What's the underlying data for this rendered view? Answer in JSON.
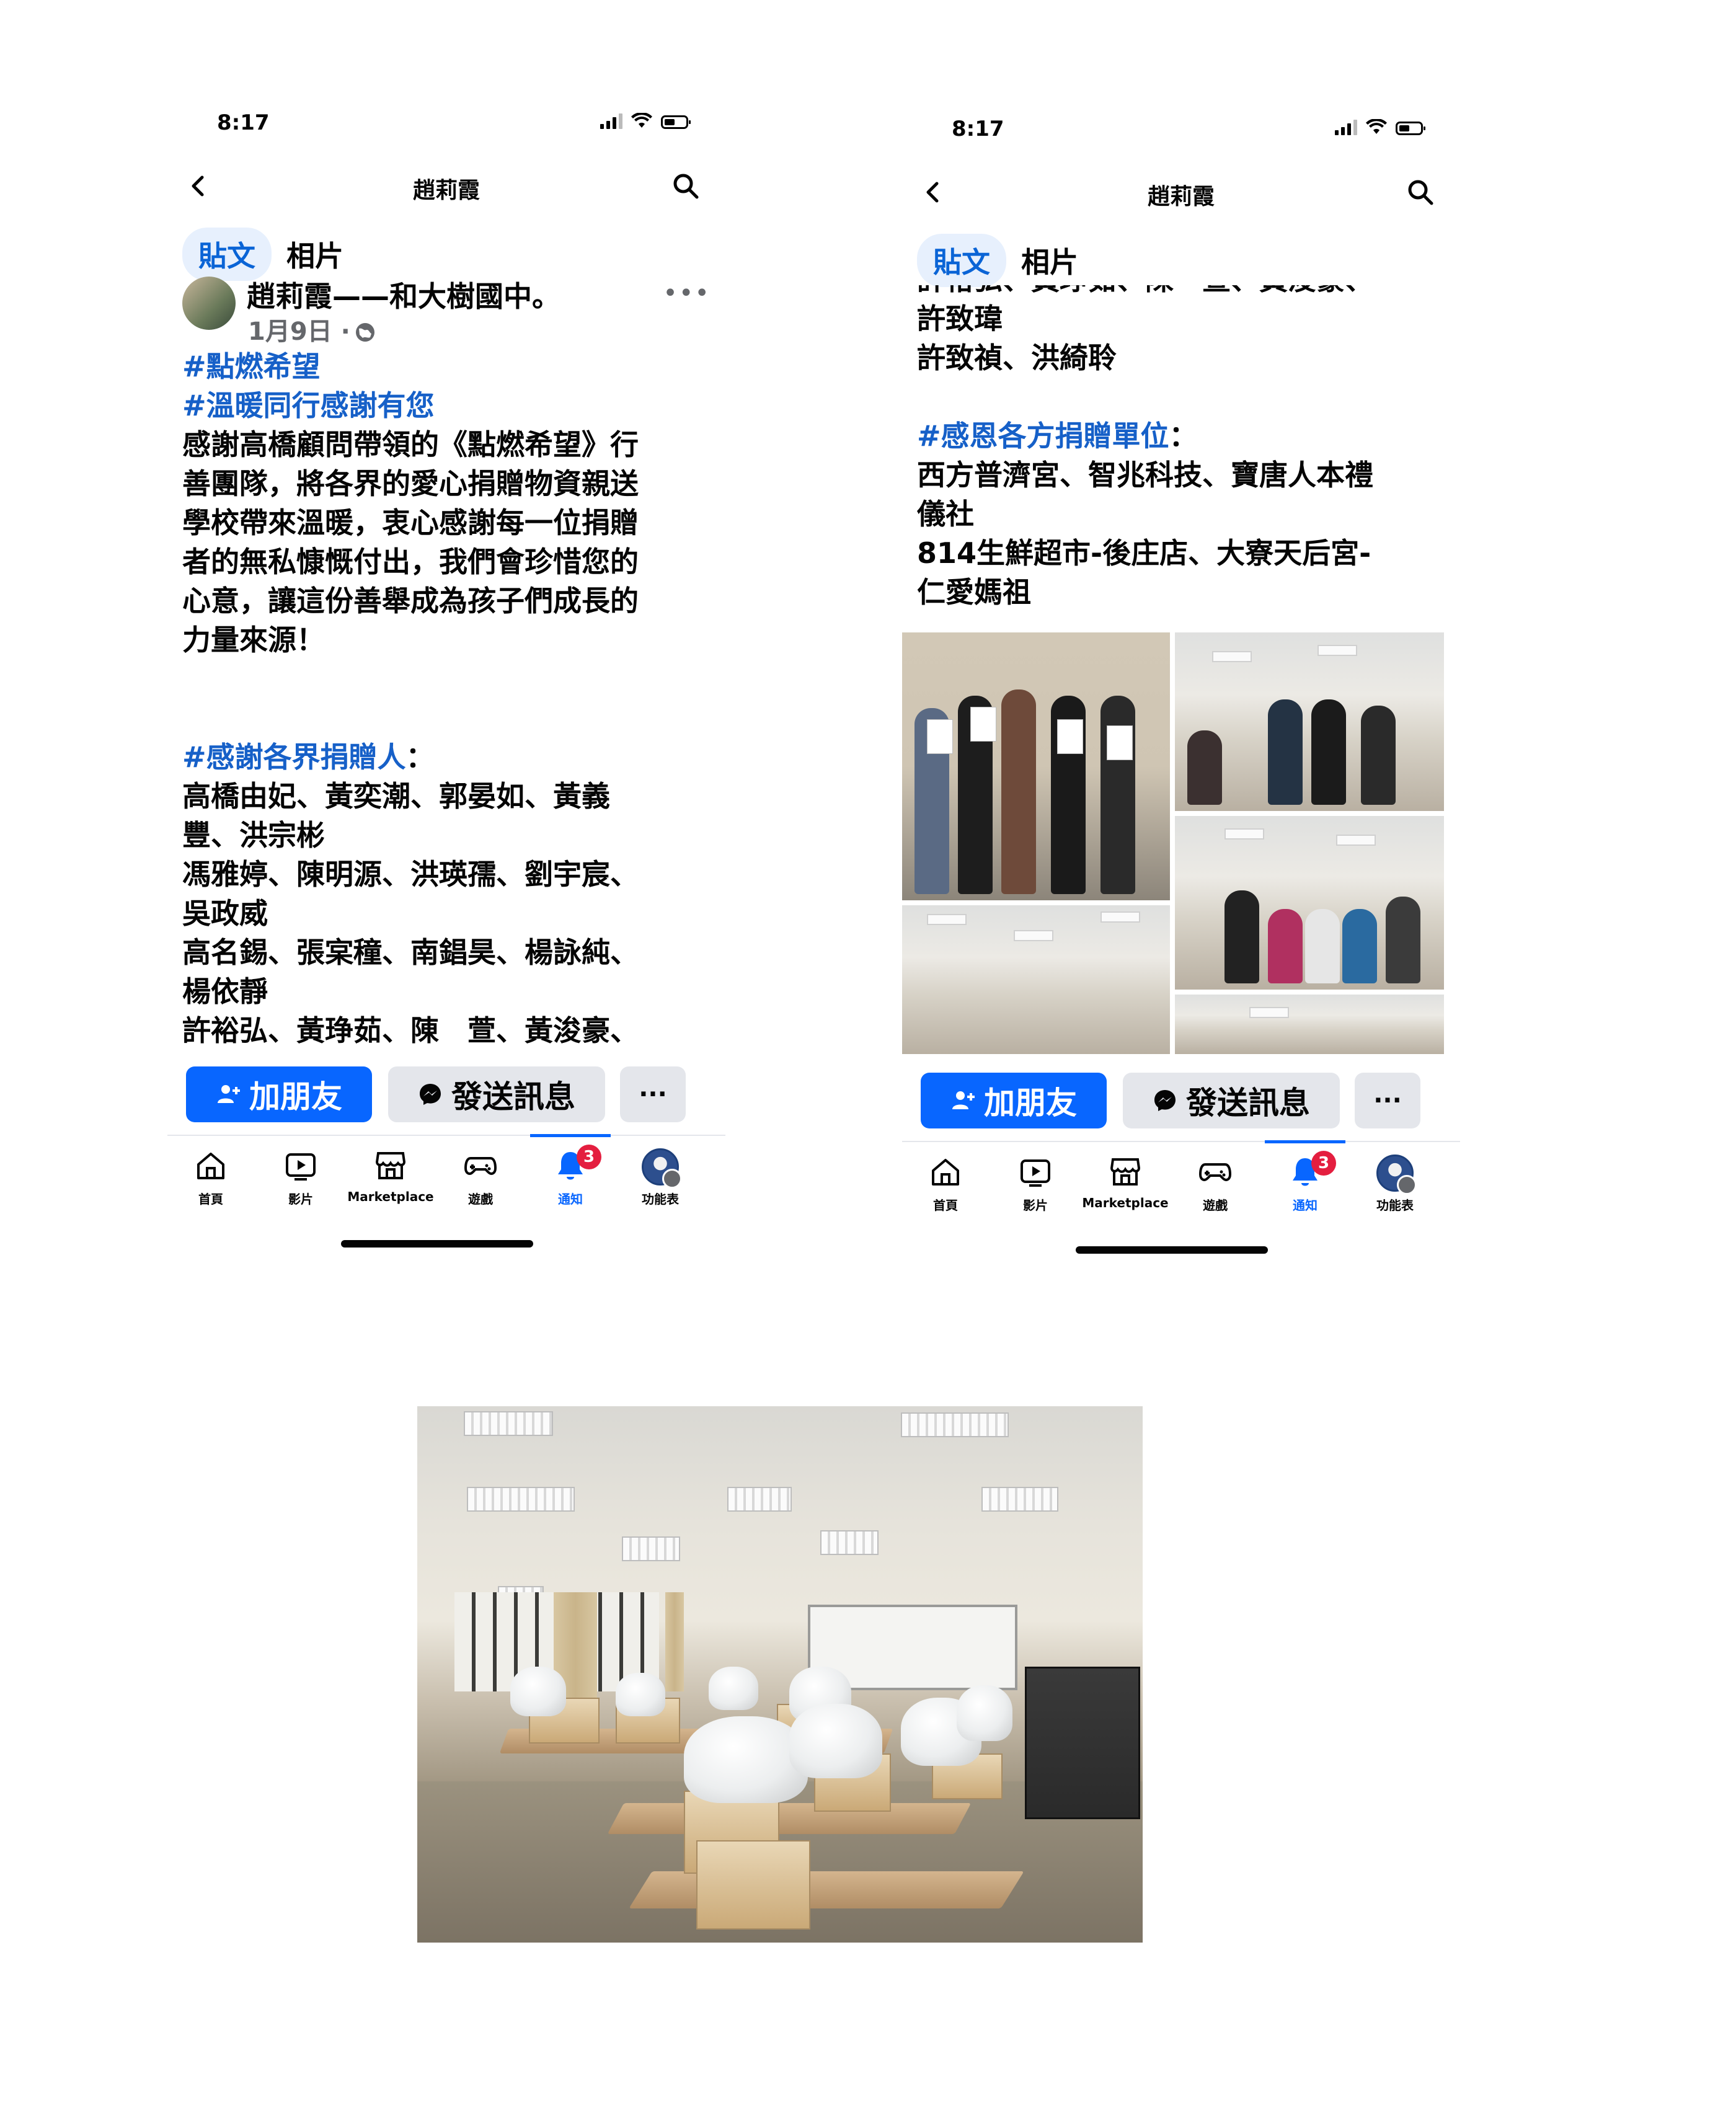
{
  "screens": [
    {
      "status": {
        "time": "8:17"
      },
      "nav": {
        "title": "趙莉霞"
      },
      "tabs": [
        "貼文",
        "相片"
      ],
      "post": {
        "author": "趙莉霞——和大樹國中。",
        "date": "1月9日 ·",
        "hashtag1": "#點燃希望",
        "hashtag2": "#溫暖同行感謝有您",
        "body": [
          "感謝高橋顧問帶領的《點燃希望》行",
          "善團隊，將各界的愛心捐贈物資親送",
          "學校帶來溫暖，衷心感謝每一位捐贈",
          "者的無私慷慨付出，我們會珍惜您的",
          "心意，讓這份善舉成為孩子們成長的",
          "力量來源！"
        ],
        "donors_tag": "#感謝各界捐贈人",
        "donors_colon": "：",
        "donors": [
          "高橋由妃、黃奕潮、郭晏如、黃義",
          "豐、洪宗彬",
          "馮雅婷、陳明源、洪瑛孺、劉宇宸、",
          "吳政威",
          "高名錫、張宲穜、南錩昊、楊詠純、",
          "楊依靜",
          "許裕弘、黃琤茹、陳　萱、黃浚豪、"
        ]
      }
    },
    {
      "status": {
        "time": "8:17"
      },
      "nav": {
        "title": "趙莉霞"
      },
      "tabs": [
        "貼文",
        "相片"
      ],
      "post": {
        "donors_cont": [
          "許裕弘、黃琤茹、陳　萱、黃浚豪、",
          "許致瑋",
          "許致禎、洪綺聆"
        ],
        "units_tag": "#感恩各方捐贈單位",
        "units_colon": "：",
        "units": [
          "西方普濟宮、智兆科技、寶唐人本禮",
          "儀社",
          "814生鮮超市-後庄店、大寮天后宮-",
          "仁愛媽祖"
        ]
      }
    }
  ],
  "actions": {
    "add_friend": "加朋友",
    "send_message": "發送訊息",
    "more": "···"
  },
  "bottom_tabs": [
    {
      "label": "首頁",
      "icon": "home-icon"
    },
    {
      "label": "影片",
      "icon": "video-icon"
    },
    {
      "label": "Marketplace",
      "icon": "marketplace-icon"
    },
    {
      "label": "遊戲",
      "icon": "gaming-icon"
    },
    {
      "label": "通知",
      "icon": "bell-icon",
      "badge": "3",
      "active": true
    },
    {
      "label": "功能表",
      "icon": "profile-menu-icon"
    }
  ],
  "colors": {
    "facebook_blue": "#0866ff",
    "hashtag": "#1660c8",
    "badge_red": "#e41e3f",
    "tab_active_bg": "#e7f0fd"
  }
}
